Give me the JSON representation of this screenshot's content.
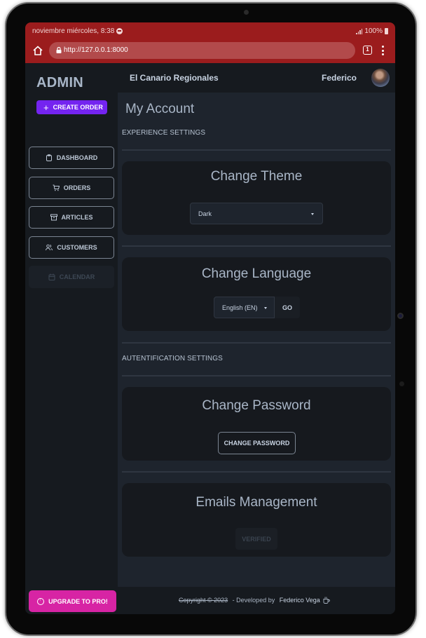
{
  "status_bar": {
    "datetime": "noviembre miércoles, 8:38",
    "battery": "100%"
  },
  "browser": {
    "url": "http://127.0.0.1:8000",
    "tab_count": "1"
  },
  "sidebar": {
    "brand": "ADMIN",
    "create_order_label": "CREATE ORDER",
    "items": [
      {
        "label": "DASHBOARD",
        "icon": "clipboard-icon",
        "enabled": true
      },
      {
        "label": "ORDERS",
        "icon": "cart-icon",
        "enabled": true
      },
      {
        "label": "ARTICLES",
        "icon": "archive-icon",
        "enabled": true
      },
      {
        "label": "CUSTOMERS",
        "icon": "users-icon",
        "enabled": true
      },
      {
        "label": "CALENDAR",
        "icon": "calendar-icon",
        "enabled": false
      }
    ],
    "upgrade_label": "UPGRADE TO PRO!"
  },
  "topbar": {
    "site_name": "El Canario Regionales",
    "user_name": "Federico"
  },
  "main": {
    "page_title": "My Account",
    "experience_section": "EXPERIENCE SETTINGS",
    "auth_section": "AUTENTIFICATION SETTINGS",
    "theme_card": {
      "title": "Change Theme",
      "selected": "Dark"
    },
    "language_card": {
      "title": "Change Language",
      "selected": "English (EN)",
      "go_label": "GO"
    },
    "password_card": {
      "title": "Change Password",
      "button_label": "CHANGE PASSWORD"
    },
    "emails_card": {
      "title": "Emails Management",
      "button_label": "VERIFIED"
    }
  },
  "footer": {
    "copyright": "Copyright © 2023",
    "developed_by": " - Developed by ",
    "author": "Federico Vega"
  },
  "colors": {
    "browser_chrome": "#9b1c1d",
    "create_order": "#7424f0",
    "upgrade": "#d724a4",
    "background": "#1e242d",
    "card": "#16191e"
  }
}
